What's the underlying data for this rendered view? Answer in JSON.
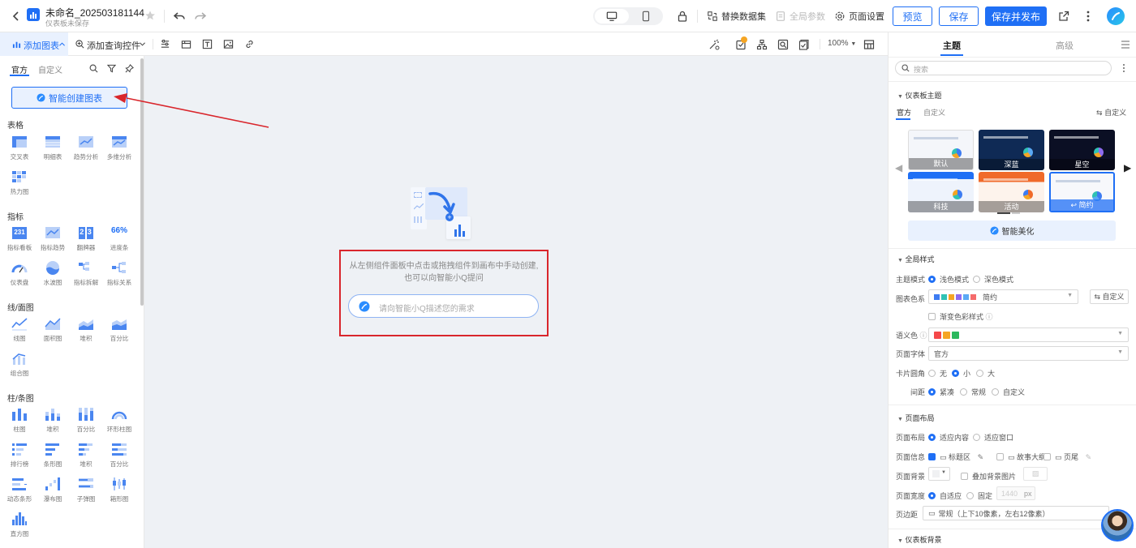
{
  "header": {
    "doc_title": "未命名_202503181144",
    "doc_status": "仪表板未保存",
    "replace_dataset": "替换数据集",
    "global_params": "全局参数",
    "page_settings": "页面设置",
    "preview": "预览",
    "save": "保存",
    "save_publish": "保存并发布"
  },
  "toolbar": {
    "add_chart": "添加图表",
    "add_query": "添加查询控件",
    "zoom": "100%"
  },
  "left": {
    "tab_official": "官方",
    "tab_custom": "自定义",
    "smart_create": "智能创建图表",
    "sections": {
      "table": "表格",
      "metric": "指标",
      "line": "线/面图",
      "bar": "柱/条图"
    },
    "table_items": [
      "交叉表",
      "明细表",
      "趋势分析",
      "多维分析",
      "热力图"
    ],
    "metric_items": [
      "指标看板",
      "指标趋势",
      "翻牌器",
      "进度条",
      "仪表盘",
      "水波图",
      "指标拆解",
      "指标关系"
    ],
    "metric_tile_texts": [
      "231",
      "2 3",
      "66%"
    ],
    "line_items": [
      "线图",
      "面积图",
      "堆积",
      "百分比",
      "组合图"
    ],
    "bar_items": [
      "柱图",
      "堆积",
      "百分比",
      "环形柱图",
      "排行榜",
      "条形图",
      "堆积",
      "百分比",
      "动态条形",
      "瀑布图",
      "子弹图",
      "箱形图",
      "直方图"
    ]
  },
  "canvas": {
    "hint_line1": "从左侧组件面板中点击或拖拽组件到画布中手动创建,",
    "hint_line2": "也可以向智能小Q提问",
    "ask_placeholder": "请向智能小Q描述您的需求"
  },
  "right": {
    "tab_theme": "主题",
    "tab_advanced": "高级",
    "search_placeholder": "搜索",
    "dash_theme": "仪表板主题",
    "theme_official": "官方",
    "theme_custom": "自定义",
    "theme_custom_btn": "自定义",
    "themes": [
      "默认",
      "深蓝",
      "星空",
      "科技",
      "活动",
      "简约"
    ],
    "beautify": "智能美化",
    "global_style": "全局样式",
    "theme_mode": "主题模式",
    "light": "浅色模式",
    "dark": "深色模式",
    "chart_color": "图表色系",
    "chart_color_value": "简约",
    "custom": "自定义",
    "gradient": "渐变色彩样式",
    "semantic_color": "语义色",
    "page_font": "页面字体",
    "page_font_value": "官方",
    "card_radius": "卡片圆角",
    "radius_none": "无",
    "radius_small": "小",
    "radius_large": "大",
    "spacing": "间距",
    "compact": "紧凑",
    "normal": "常规",
    "spacing_custom": "自定义",
    "page_layout_title": "页面布局",
    "page_layout": "页面布局",
    "fit_content": "适应内容",
    "fit_window": "适应窗口",
    "page_info": "页面信息",
    "title_area": "标题区",
    "story": "故事大纲",
    "footer": "页尾",
    "page_bg": "页面背景",
    "bg_image": "叠加背景图片",
    "page_width": "页面宽度",
    "auto_fit": "自适应",
    "fixed": "固定",
    "width_value": "1440",
    "px": "px",
    "margin": "页边距",
    "margin_value": "常规（上下10像素，左右12像素）",
    "dash_bg": "仪表板背景"
  },
  "colors": {
    "primary": "#1f6ff5",
    "annotation": "#d9262c",
    "palette": [
      "#3d7cf2",
      "#2fc2b4",
      "#f5a524",
      "#8e6cf0",
      "#5aa9f5",
      "#f56b6b"
    ],
    "semantic": [
      "#f5484a",
      "#f5a524",
      "#2bb85c"
    ]
  }
}
